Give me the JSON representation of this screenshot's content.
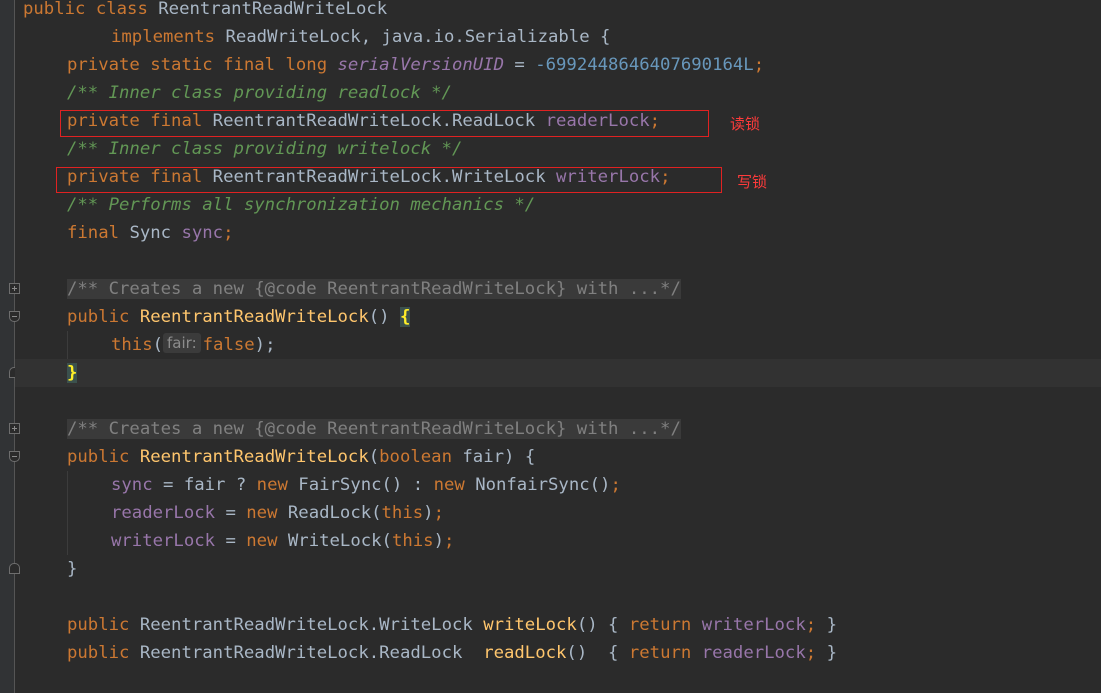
{
  "code": {
    "l1": {
      "kw": "public class ",
      "name": "ReentrantReadWriteLock"
    },
    "l2": {
      "kw": "implements ",
      "rest": "ReadWriteLock, java.io.Serializable {"
    },
    "l3": {
      "kw": "private static final long ",
      "field": "serialVersionUID",
      "eq": " = ",
      "num": "-6992448646407690164L",
      "semi": ";"
    },
    "l4": {
      "comment": "/** Inner class providing readlock */"
    },
    "l5": {
      "kw": "private final ",
      "type": "ReentrantReadWriteLock.ReadLock ",
      "field": "readerLock",
      "semi": ";"
    },
    "l6": {
      "comment": "/** Inner class providing writelock */"
    },
    "l7": {
      "kw": "private final ",
      "type": "ReentrantReadWriteLock.WriteLock ",
      "field": "writerLock",
      "semi": ";"
    },
    "l8": {
      "comment": "/** Performs all synchronization mechanics */"
    },
    "l9": {
      "kw": "final ",
      "type": "Sync ",
      "field": "sync",
      "semi": ";"
    },
    "l11": {
      "collapsed": "/** Creates a new {@code ReentrantReadWriteLock} with ...*/"
    },
    "l12": {
      "kw": "public ",
      "mth": "ReentrantReadWriteLock",
      "paren": "() ",
      "brace": "{"
    },
    "l13": {
      "kw": "this",
      "open": "(",
      "hint": "fair:",
      "kw2": "false",
      "close": ");"
    },
    "l14": {
      "brace": "}"
    },
    "l16": {
      "collapsed": "/** Creates a new {@code ReentrantReadWriteLock} with ...*/"
    },
    "l17": {
      "kw": "public ",
      "mth": "ReentrantReadWriteLock",
      "open": "(",
      "kw2": "boolean ",
      "rest": "fair) {"
    },
    "l18": {
      "field": "sync",
      "a": " = fair ? ",
      "kw": "new ",
      "b": "FairSync() : ",
      "kw2": "new ",
      "c": "NonfairSync()",
      "semi": ";"
    },
    "l19": {
      "field": "readerLock",
      "a": " = ",
      "kw": "new ",
      "b": "ReadLock(",
      "kw2": "this",
      "c": ")",
      "semi": ";"
    },
    "l20": {
      "field": "writerLock",
      "a": " = ",
      "kw": "new ",
      "b": "WriteLock(",
      "kw2": "this",
      "c": ")",
      "semi": ";"
    },
    "l21": {
      "brace": "}"
    },
    "l23": {
      "kw": "public ",
      "type": "ReentrantReadWriteLock.WriteLock ",
      "mth": "writeLock",
      "a": "() { ",
      "kw2": "return ",
      "field": "writerLock",
      "semi": "; ",
      "close": "}"
    },
    "l24": {
      "kw": "public ",
      "type": "ReentrantReadWriteLock.ReadLock  ",
      "mth": "readLock",
      "a": "()  { ",
      "kw2": "return ",
      "field": "readerLock",
      "semi": "; ",
      "close": "}"
    }
  },
  "annotations": {
    "read_lock": "读锁",
    "write_lock": "写锁"
  },
  "colors": {
    "background": "#2b2b2b",
    "keyword": "#cc7832",
    "comment": "#629755",
    "field": "#9876aa",
    "number": "#6897bb",
    "method": "#ffc66d",
    "annotation": "#e02222"
  }
}
